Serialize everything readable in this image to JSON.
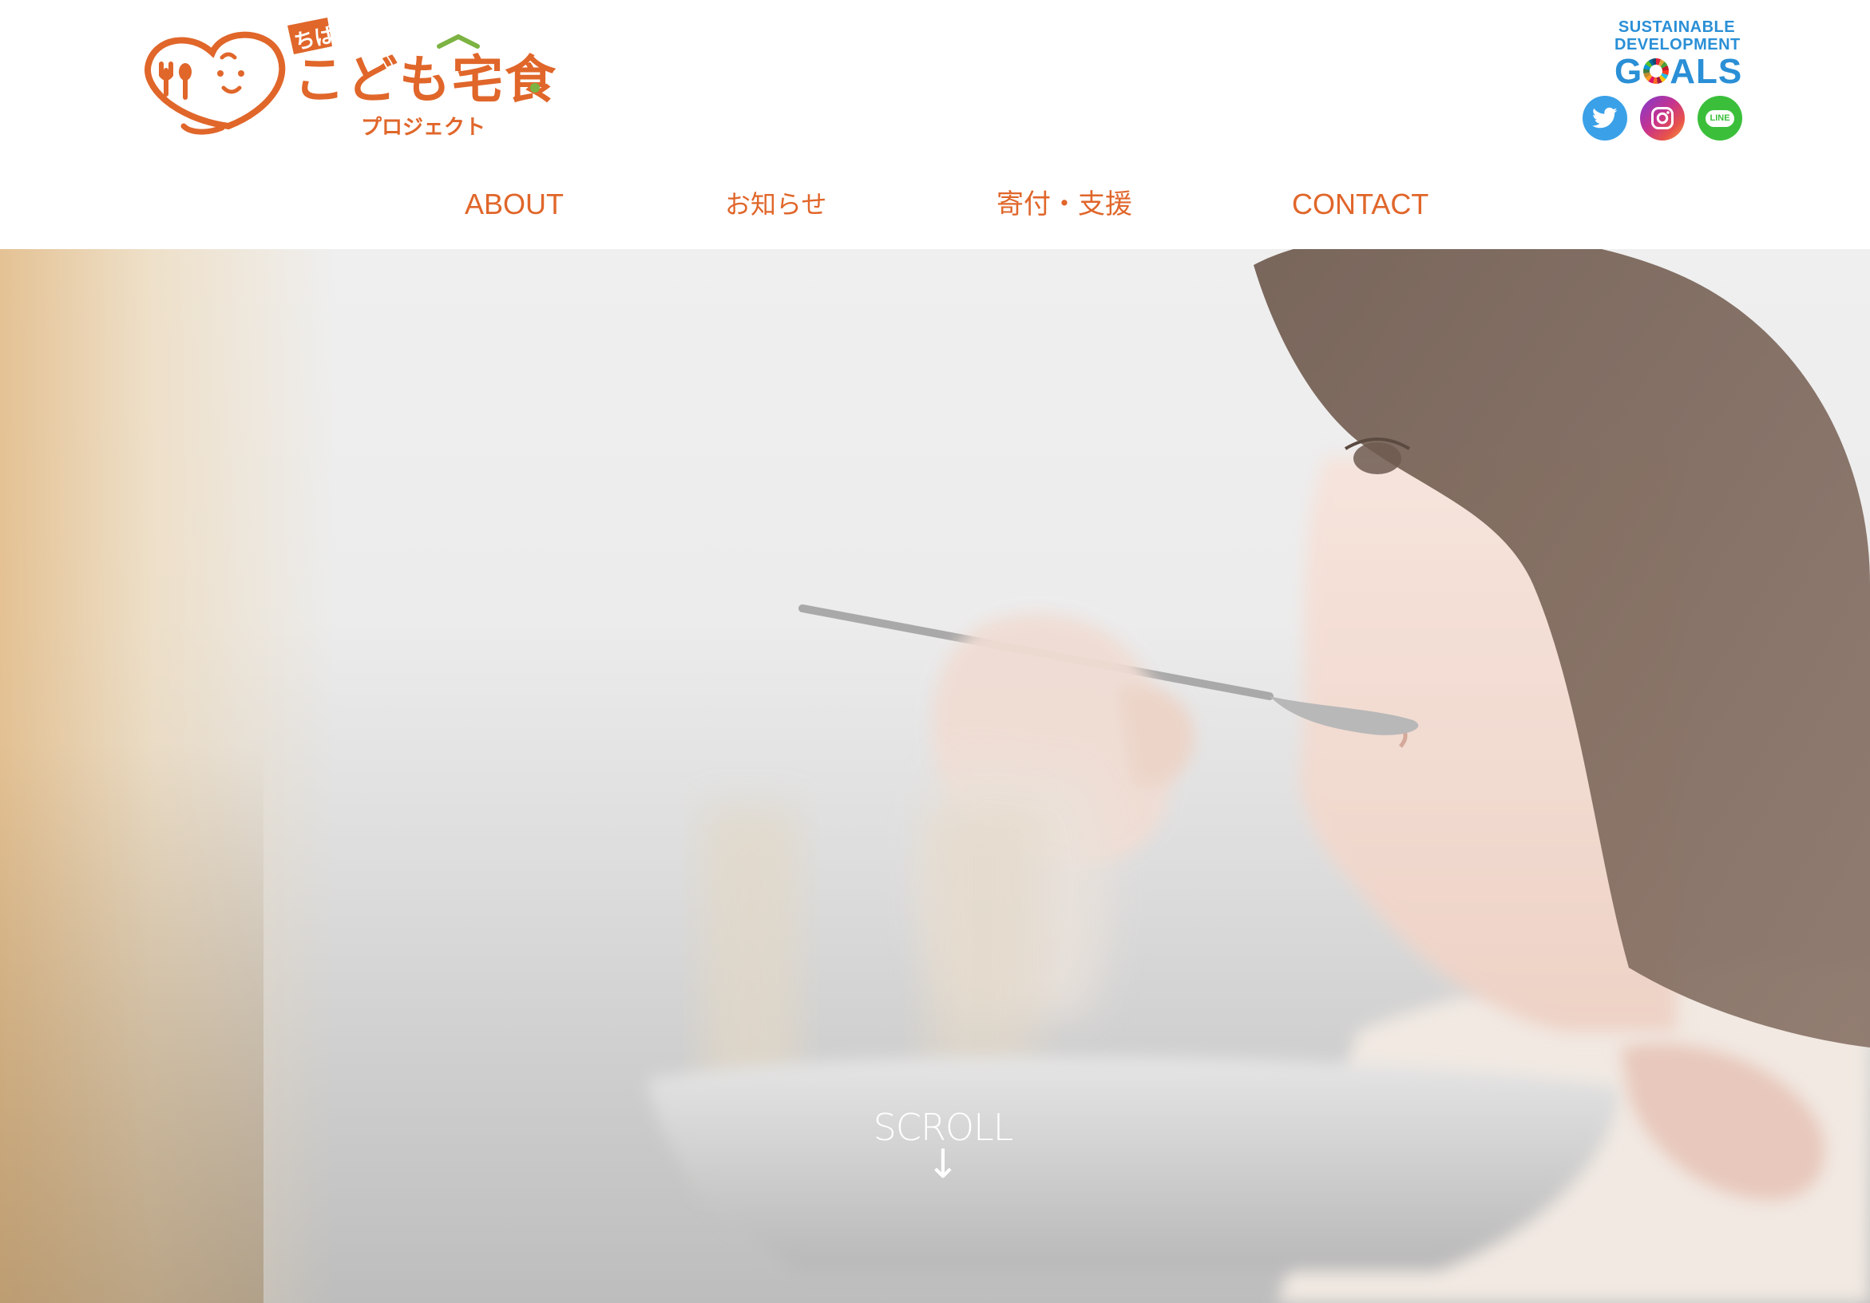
{
  "header": {
    "logo": {
      "name": "ちばこども宅食プロジェクト",
      "top_text": "ちば",
      "main_text": "こども宅食",
      "sub_text": "プロジェクト"
    },
    "sdgs": {
      "line1": "SUSTAINABLE",
      "line2": "DEVELOPMENT",
      "goals_pre": "G",
      "goals_post": "ALS"
    },
    "social": [
      {
        "icon": "twitter-icon"
      },
      {
        "icon": "instagram-icon"
      },
      {
        "icon": "line-icon",
        "label": "LINE"
      }
    ],
    "colors": {
      "accent": "#e0662a",
      "sdgs_blue": "#2a8fd6",
      "twitter": "#3aa1e8",
      "line": "#3bbf3b"
    }
  },
  "nav": {
    "items": [
      {
        "label": "ABOUT"
      },
      {
        "label": "お知らせ"
      },
      {
        "label": "寄付・支援"
      },
      {
        "label": "CONTACT"
      }
    ]
  },
  "hero": {
    "image": "child-eating-with-spoon-photo",
    "scroll_label": "SCROLL",
    "scroll_arrow": "↓"
  }
}
